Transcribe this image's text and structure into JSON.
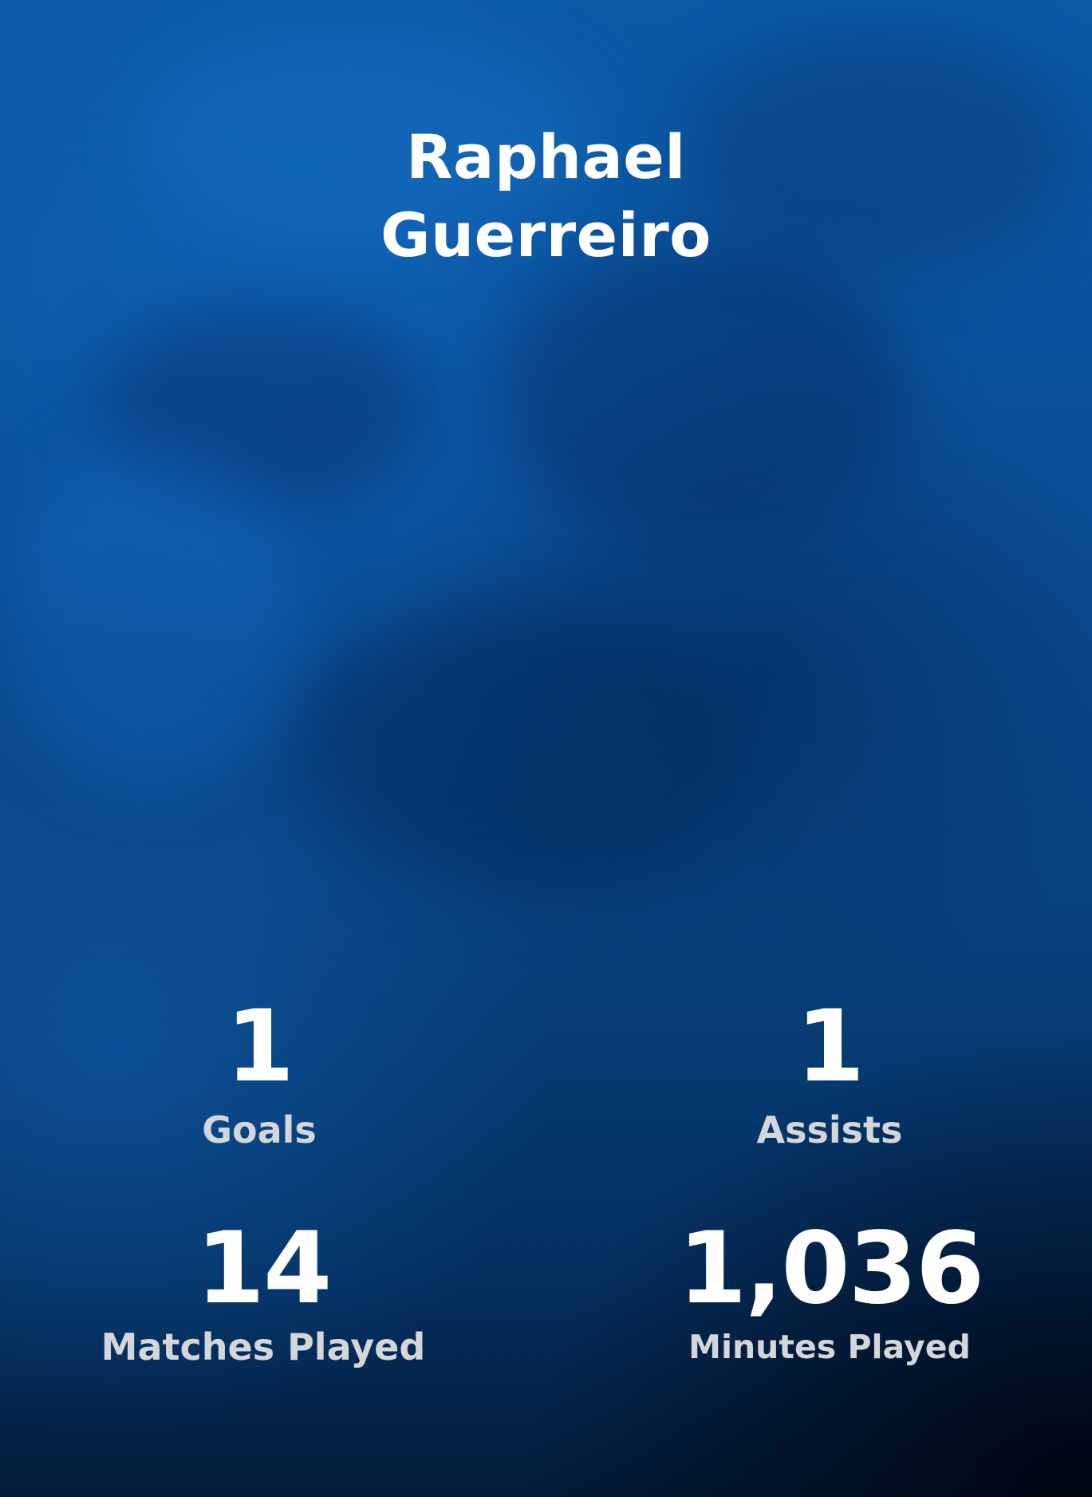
{
  "player": {
    "first_name": "Raphael",
    "last_name": "Guerreiro"
  },
  "stats": {
    "goals": {
      "value": "1",
      "label": "Goals"
    },
    "assists": {
      "value": "1",
      "label": "Assists"
    },
    "matches": {
      "value": "14",
      "label": "Matches Played"
    },
    "minutes": {
      "value": "1,036",
      "label": "Minutes Played"
    }
  },
  "colors": {
    "background_top": "#0b5aa6",
    "background_bottom": "#031c3a",
    "text_primary": "#ffffff",
    "text_secondary": "#d3d6db"
  }
}
